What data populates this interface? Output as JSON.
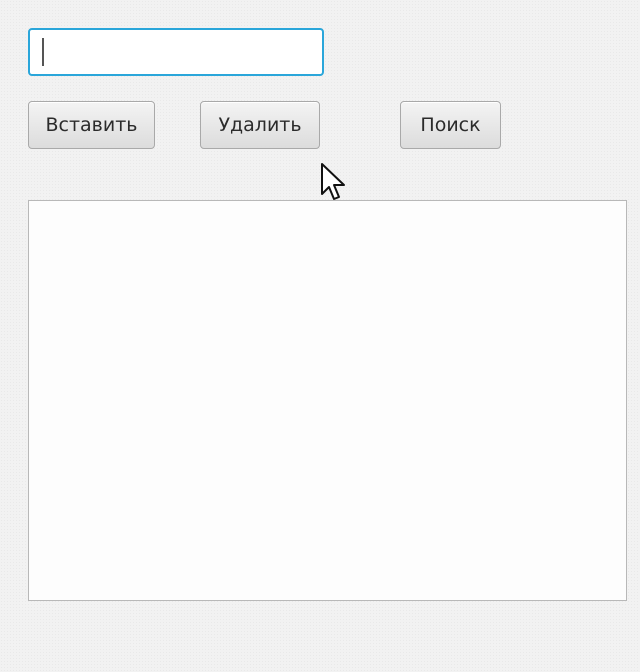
{
  "input": {
    "value": "",
    "placeholder": ""
  },
  "buttons": {
    "insert_label": "Вставить",
    "delete_label": "Удалить",
    "search_label": "Поиск"
  },
  "colors": {
    "focus_border": "#2aa6da",
    "background": "#f2f2f2",
    "button_border": "#a9a9a9"
  },
  "icons": {
    "cursor": "mouse-pointer-icon"
  }
}
